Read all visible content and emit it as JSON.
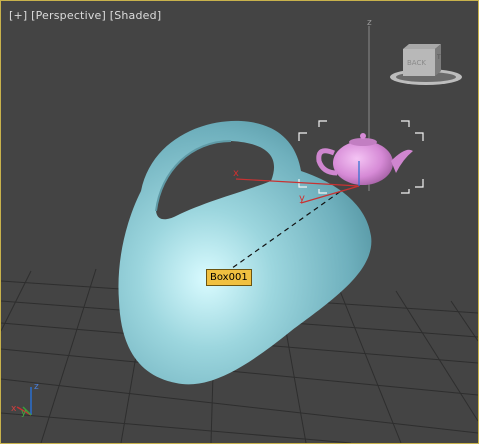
{
  "viewport": {
    "label_plus": "[+]",
    "label_view": "[Perspective]",
    "label_shading": "[Shaded]"
  },
  "viewcube": {
    "face_label": "BACK",
    "side_label": "T"
  },
  "gizmo": {
    "x_axis": "x",
    "y_axis": "y",
    "z_axis": "z"
  },
  "object_tooltip": "Box001",
  "world_axis": {
    "x": "x",
    "y": "y",
    "z": "z"
  },
  "colors": {
    "viewport_bg": "#444444",
    "active_border": "#c8b24c",
    "object_color": "#8fd0dc",
    "teapot_color": "#d98ad9",
    "tooltip_bg": "#f0c040"
  }
}
